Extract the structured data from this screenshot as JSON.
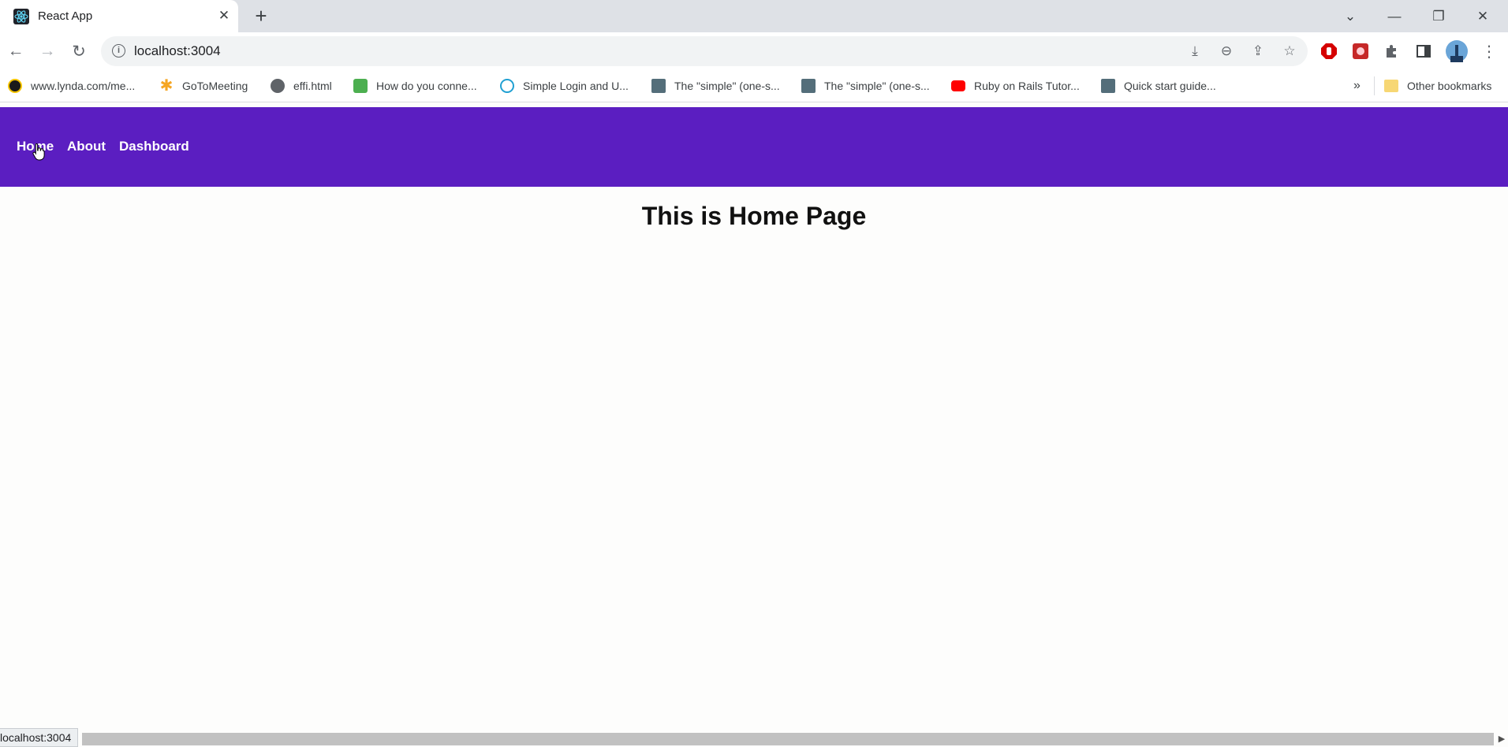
{
  "browser": {
    "tab": {
      "title": "React App",
      "close_glyph": "✕"
    },
    "new_tab_glyph": "+",
    "window_controls": {
      "tab_search": "⌄",
      "minimize": "—",
      "restore": "❐",
      "close": "✕"
    },
    "nav": {
      "back": "←",
      "forward": "→",
      "reload": "↻"
    },
    "address": {
      "url": "localhost:3004",
      "info_glyph": "i"
    },
    "omnibox_actions": {
      "install": "⤓",
      "zoom": "⊖",
      "share": "⇪",
      "bookmark": "☆"
    },
    "toolbar_menu": "⋮",
    "bookmarks": [
      {
        "label": "www.lynda.com/me...",
        "icon": "lynda-icon",
        "color": "#1a1a1a"
      },
      {
        "label": "GoToMeeting",
        "icon": "gotomeeting-icon",
        "color": "#f5a623"
      },
      {
        "label": "effi.html",
        "icon": "globe-icon",
        "color": "#5f6368"
      },
      {
        "label": "How do you conne...",
        "icon": "cube-icon",
        "color": "#4caf50"
      },
      {
        "label": "Simple Login and U...",
        "icon": "wordpress-icon",
        "color": "#21a0d2"
      },
      {
        "label": "The \"simple\" (one-s...",
        "icon": "docs-icon",
        "color": "#546e7a"
      },
      {
        "label": "The \"simple\" (one-s...",
        "icon": "docs-icon",
        "color": "#546e7a"
      },
      {
        "label": "Ruby on Rails Tutor...",
        "icon": "youtube-icon",
        "color": "#ff0000"
      },
      {
        "label": "Quick start guide...",
        "icon": "docs-icon",
        "color": "#546e7a"
      }
    ],
    "more_bookmarks_glyph": "»",
    "other_bookmarks": {
      "label": "Other bookmarks",
      "icon": "folder-icon",
      "color": "#f7d774"
    }
  },
  "page": {
    "nav_color": "#5b1ec1",
    "nav": {
      "home": "Home",
      "about": "About",
      "dashboard": "Dashboard"
    },
    "heading": "This is Home Page"
  },
  "status_bar": {
    "url": "localhost:3004",
    "scroll_arrow": "▶"
  }
}
